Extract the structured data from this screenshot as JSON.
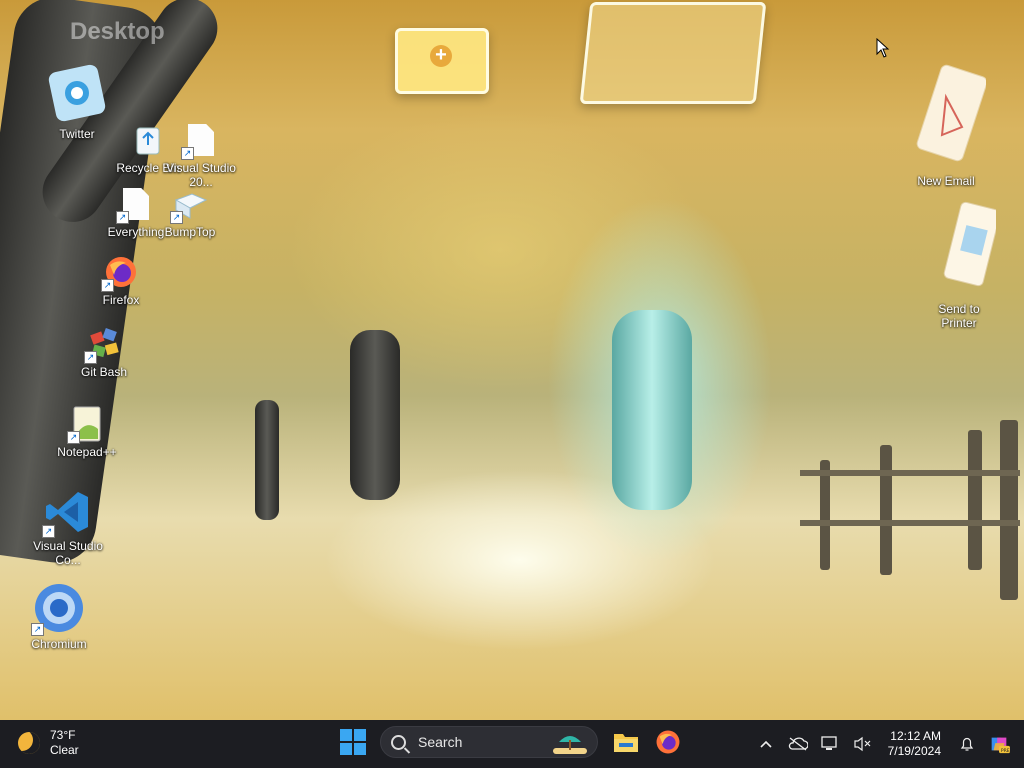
{
  "desktop": {
    "title": "Desktop",
    "icons": [
      {
        "label": "Twitter"
      },
      {
        "label": "Recycle Bin"
      },
      {
        "label": "Visual Studio 20..."
      },
      {
        "label": "Everything"
      },
      {
        "label": "BumpTop"
      },
      {
        "label": "Firefox"
      },
      {
        "label": "Git Bash"
      },
      {
        "label": "Notepad++"
      },
      {
        "label": "Visual Studio Co..."
      },
      {
        "label": "Chromium"
      },
      {
        "label": "New Email"
      },
      {
        "label": "Send to Printer"
      }
    ]
  },
  "taskbar": {
    "weather": {
      "temp": "73°F",
      "condition": "Clear"
    },
    "search": {
      "placeholder": "Search"
    },
    "clock": {
      "time": "12:12 AM",
      "date": "7/19/2024"
    }
  },
  "colors": {
    "taskbar_bg": "#1c1d22",
    "windows_blue": "#3aa7f2",
    "folder_yellow": "#f5c84a",
    "firefox_orange": "#ff7139"
  }
}
